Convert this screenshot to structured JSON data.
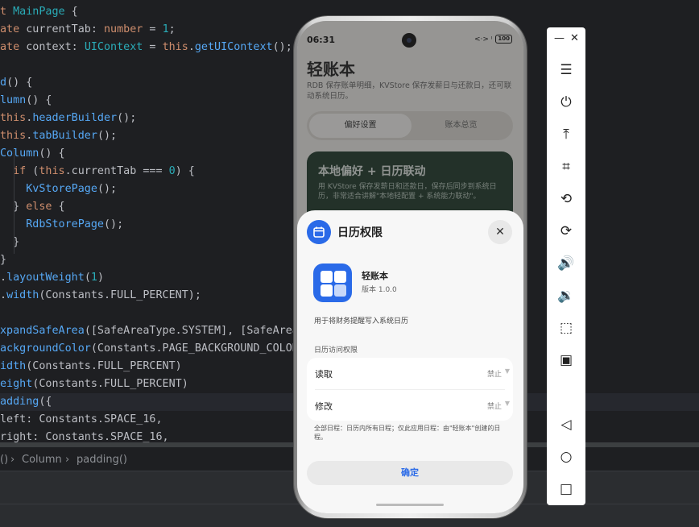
{
  "editor": {
    "lines": [
      {
        "html": "<span class=\"kw\">t</span> <span class=\"ty\">MainPage</span> {"
      },
      {
        "html": "<span class=\"kw\">ate</span> currentTab: <span class=\"kw\">number</span> = <span class=\"num\">1</span>;"
      },
      {
        "html": "<span class=\"kw\">ate</span> context: <span class=\"ty\">UIContext</span> = <span class=\"kw\">this</span>.<span class=\"fn\">getUIContext</span>();"
      },
      {
        "html": ""
      },
      {
        "html": "<span class=\"fn\">d</span>() {"
      },
      {
        "html": "<span class=\"fn\">lumn</span>() {"
      },
      {
        "html": "<span class=\"kw\">this</span>.<span class=\"fn\">headerBuilder</span>();"
      },
      {
        "html": "<span class=\"kw\">this</span>.<span class=\"fn\">tabBuilder</span>();"
      },
      {
        "html": "<span class=\"fn\">Column</span>() {"
      },
      {
        "html": "  <span class=\"kw\">if</span> (<span class=\"kw\">this</span>.currentTab === <span class=\"num\">0</span>) {"
      },
      {
        "html": "    <span class=\"fn\">KvStorePage</span>();"
      },
      {
        "html": "  } <span class=\"kw\">else</span> {"
      },
      {
        "html": "    <span class=\"fn\">RdbStorePage</span>();"
      },
      {
        "html": "  }"
      },
      {
        "html": "}"
      },
      {
        "html": ".<span class=\"fn\">layoutWeight</span>(<span class=\"num\">1</span>)"
      },
      {
        "html": ".<span class=\"fn\">width</span>(Constants.FULL_PERCENT);"
      },
      {
        "html": ""
      },
      {
        "html": "<span class=\"fn\">xpandSafeArea</span>([SafeAreaType.SYSTEM], [SafeArea"
      },
      {
        "html": "<span class=\"fn\">ackgroundColor</span>(Constants.PAGE_BACKGROUND_COLOR"
      },
      {
        "html": "<span class=\"fn\">idth</span>(Constants.FULL_PERCENT)"
      },
      {
        "html": "<span class=\"fn\">eight</span>(Constants.FULL_PERCENT)"
      },
      {
        "html": "<span class=\"fn\">adding</span>({"
      },
      {
        "html": "left: Constants.SPACE_16,"
      },
      {
        "html": "right: Constants.SPACE_16,"
      }
    ],
    "breadcrumb": [
      "()",
      "›",
      "Column",
      "›",
      "padding()"
    ]
  },
  "phone": {
    "status": {
      "time": "06:31",
      "icons": "<·> ᵎ",
      "battery": "100"
    },
    "app_title": "轻账本",
    "app_subtitle": "RDB 保存账单明细，KVStore 保存发薪日与还款日，还可联动系统日历。",
    "tabs": [
      "偏好设置",
      "账本总览"
    ],
    "card": {
      "title": "本地偏好 + 日历联动",
      "text": "用 KVStore 保存发薪日和还款日，保存后同步到系统日历，非常适合讲解\"本地轻配置 + 系统能力联动\"。"
    },
    "sheet": {
      "title": "日历权限",
      "app_name": "轻账本",
      "app_version": "版本 1.0.0",
      "purpose": "用于将财务提醒写入系统日历",
      "section_label": "日历访问权限",
      "permissions": [
        {
          "name": "读取",
          "value": "禁止"
        },
        {
          "name": "修改",
          "value": "禁止"
        }
      ],
      "note": "全部日程：日历内所有日程；仅此应用日程：由\"轻账本\"创建的日程。",
      "confirm": "确定"
    }
  },
  "toolbar": {
    "top": [
      "—",
      "✕"
    ],
    "buttons": [
      {
        "name": "menu-icon",
        "glyph": "☰"
      },
      {
        "name": "power-icon",
        "glyph": "⏻"
      },
      {
        "name": "pin-top-icon",
        "glyph": "⤒"
      },
      {
        "name": "crop-icon",
        "glyph": "⌗"
      },
      {
        "name": "rotate-left-icon",
        "glyph": "⟲"
      },
      {
        "name": "rotate-right-icon",
        "glyph": "⟳"
      },
      {
        "name": "volume-up-icon",
        "glyph": "🔊"
      },
      {
        "name": "volume-down-icon",
        "glyph": "🔉"
      },
      {
        "name": "shake-icon",
        "glyph": "⬚"
      },
      {
        "name": "screenshot-icon",
        "glyph": "▣"
      },
      {
        "name": "back-icon",
        "glyph": "◁"
      },
      {
        "name": "home-icon",
        "glyph": "○"
      },
      {
        "name": "recents-icon",
        "glyph": "□"
      }
    ]
  }
}
